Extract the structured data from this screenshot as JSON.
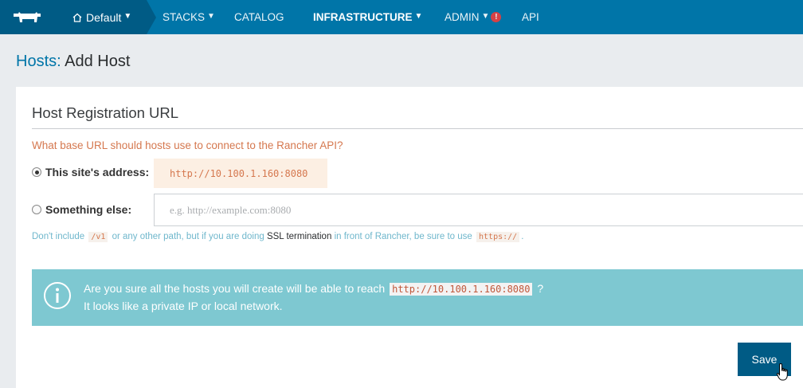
{
  "nav": {
    "environment": "Default",
    "items": [
      {
        "label": "STACKS",
        "has_dropdown": true
      },
      {
        "label": "CATALOG",
        "has_dropdown": false
      },
      {
        "label": "INFRASTRUCTURE",
        "has_dropdown": true,
        "active": true
      },
      {
        "label": "ADMIN",
        "has_dropdown": true,
        "alert": "!"
      },
      {
        "label": "API",
        "has_dropdown": false
      }
    ]
  },
  "page": {
    "crumb": "Hosts:",
    "title": "Add Host"
  },
  "form": {
    "section_title": "Host Registration URL",
    "question": "What base URL should hosts use to connect to the Rancher API?",
    "option_site_label": "This site's address:",
    "option_site_value": "http://10.100.1.160:8080",
    "option_site_selected": true,
    "option_else_label": "Something else:",
    "option_else_placeholder": "e.g. http://example.com:8080",
    "option_else_value": "",
    "hint_1": "Don't include",
    "hint_code_1": "/v1",
    "hint_2": "or any other path, but if you are doing",
    "hint_link": "SSL termination",
    "hint_3": "in front of Rancher, be sure to use",
    "hint_code_2": "https://",
    "hint_4": "."
  },
  "info": {
    "line1_before": "Are you sure all the hosts you will create will be able to reach",
    "line1_code": "http://10.100.1.160:8080",
    "line1_after": "?",
    "line2": "It looks like a private IP or local network."
  },
  "actions": {
    "save_label": "Save"
  },
  "colors": {
    "nav_bg": "#0075a8",
    "nav_dark": "#005b85",
    "accent_orange": "#d5784f",
    "info_bg": "#7ec8d1"
  }
}
